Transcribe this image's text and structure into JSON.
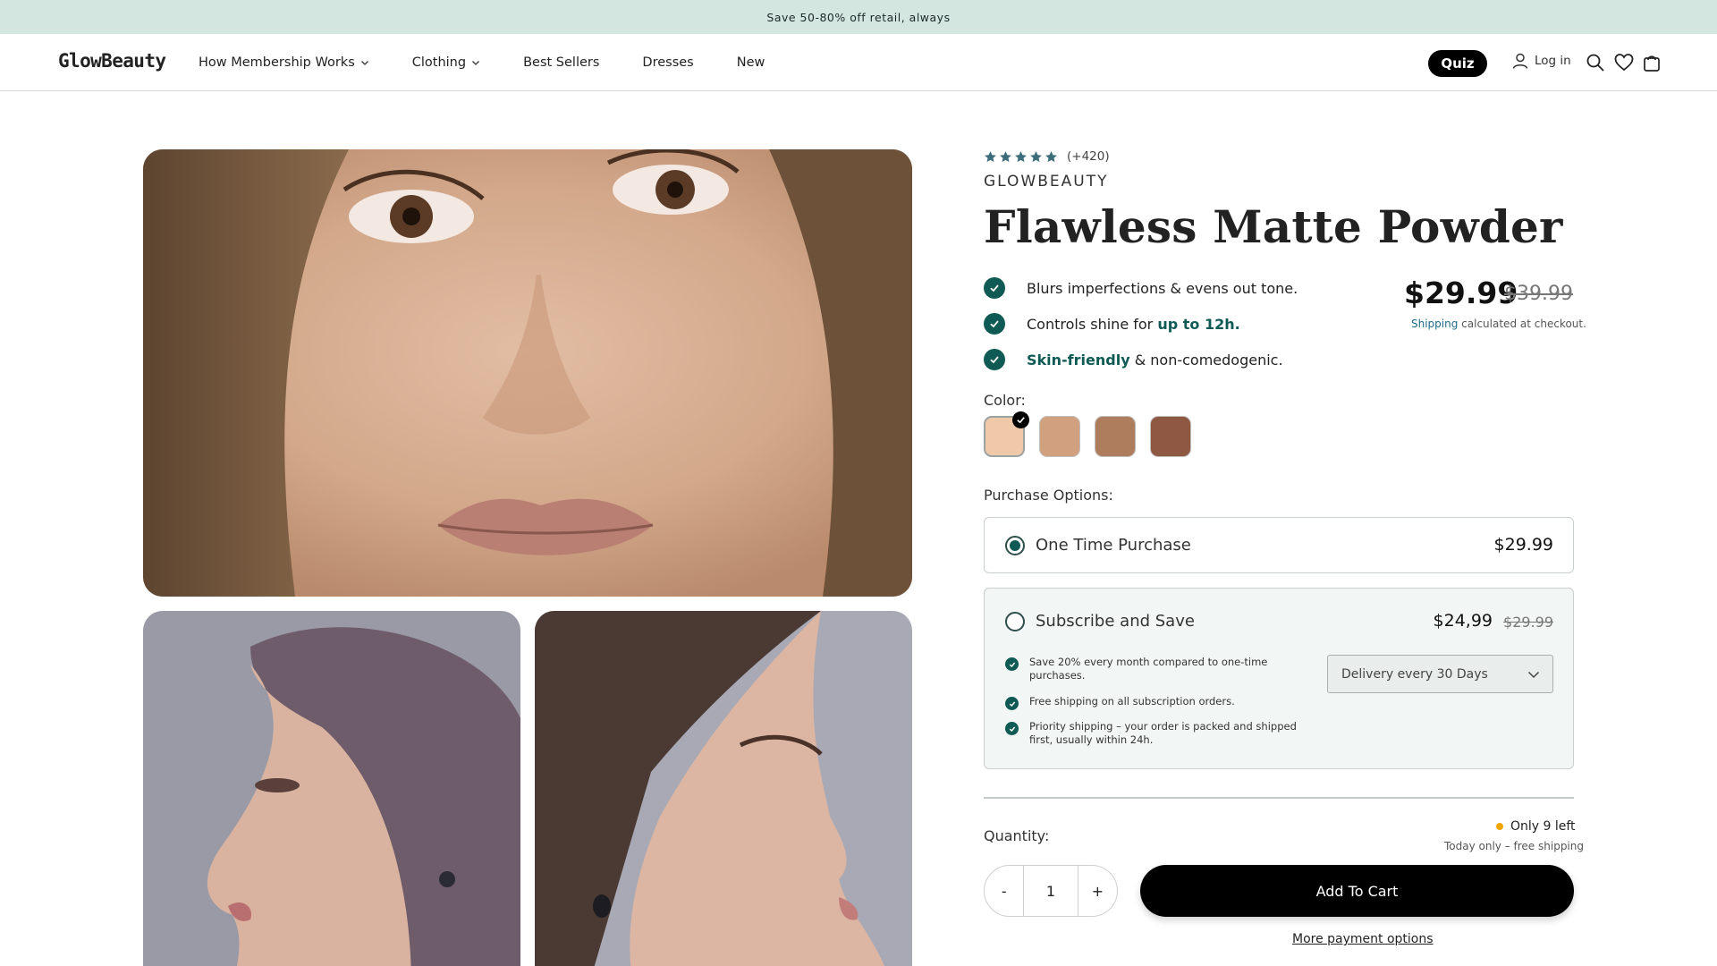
{
  "announcement": "Save 50-80% off retail, always",
  "header": {
    "logo": "GlowBeauty",
    "nav": [
      {
        "label": "How Membership Works"
      },
      {
        "label": "Clothing"
      },
      {
        "label": "Best Sellers"
      },
      {
        "label": "Dresses"
      },
      {
        "label": "New"
      }
    ],
    "quiz_label": "Quiz",
    "login_label": "Log in",
    "icons": [
      "user-icon",
      "search-icon",
      "heart-icon",
      "cart-icon",
      "chevron-down-icon"
    ]
  },
  "product": {
    "rating_stars": 5,
    "rating_count": "(+420)",
    "brand": "GLOWBEAUTY",
    "title": "Flawless Matte Powder",
    "benefits": [
      {
        "text": "Blurs imperfections & evens out tone.",
        "highlight": "",
        "rest": ""
      },
      {
        "text": "Controls shine for ",
        "highlight": "up to 12h.",
        "rest": ""
      },
      {
        "text": "",
        "highlight": "Skin-friendly",
        "rest": " & non-comedogenic."
      }
    ],
    "price": "$29.99",
    "compare_price": "$39.99",
    "shipping_link": "Shipping",
    "shipping_note": " calculated at checkout.",
    "color_label": "Color:",
    "swatches": [
      {
        "name": "light",
        "color": "#efc9a8",
        "selected": true
      },
      {
        "name": "light-medium",
        "color": "#d1a07e",
        "selected": false
      },
      {
        "name": "medium",
        "color": "#ae7d5d",
        "selected": false
      },
      {
        "name": "deep",
        "color": "#8e5843",
        "selected": false
      }
    ],
    "purchase_label": "Purchase Options:",
    "one_time": {
      "label": "One Time Purchase",
      "price": "$29.99",
      "selected": true
    },
    "subscribe": {
      "label": "Subscribe and Save",
      "price": "$24,99",
      "compare_price": "$29.99",
      "selected": false,
      "benefits": [
        "Save 20% every month compared to one-time purchases.",
        "Free shipping on all subscription orders.",
        "Priority shipping – your order is packed and shipped first, usually within 24h."
      ],
      "delivery_select": "Delivery every 30 Days"
    },
    "stock_text": "Only 9 left",
    "today_text": "Today only – free shipping",
    "quantity_label": "Quantity:",
    "quantity_minus": "-",
    "quantity_value": "1",
    "quantity_plus": "+",
    "add_to_cart": "Add To Cart",
    "more_payment": "More payment options"
  },
  "colors": {
    "accent_teal": "#0f5a54",
    "announce_bg": "#d3e6e0",
    "stock_dot": "#f0a500",
    "link_blue": "#1f6b8a"
  }
}
